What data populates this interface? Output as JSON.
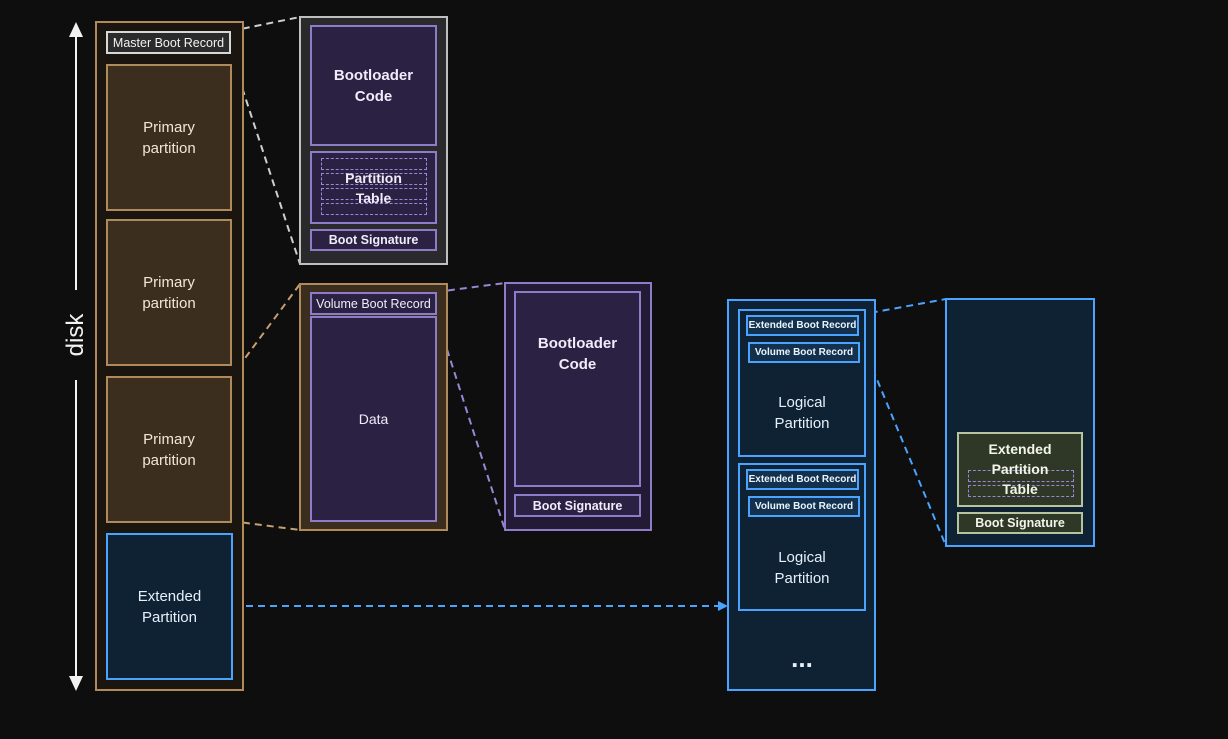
{
  "diagram": {
    "disk_label": "disk",
    "mbr_label": "Master Boot Record",
    "primary_partitions": [
      "Primary\npartition",
      "Primary\npartition",
      "Primary\npartition"
    ],
    "extended_partition": "Extended\nPartition",
    "mbr_detail": {
      "bootloader": "Bootloader\nCode",
      "partition_table": "Partition\nTable",
      "boot_signature": "Boot Signature"
    },
    "partition_detail": {
      "vbr_label": "Volume Boot Record",
      "data": "Data"
    },
    "vbr_detail": {
      "bootloader": "Bootloader\nCode",
      "boot_signature": "Boot Signature"
    },
    "logical_chain": {
      "items": [
        {
          "ebr": "Extended Boot Record",
          "vbr": "Volume Boot Record",
          "label": "Logical\nPartition"
        },
        {
          "ebr": "Extended Boot Record",
          "vbr": "Volume Boot Record",
          "label": "Logical\nPartition"
        }
      ],
      "ellipsis": "..."
    },
    "ebr_detail": {
      "partition_table": "Extended\nPartition\nTable",
      "boot_signature": "Boot Signature"
    }
  }
}
